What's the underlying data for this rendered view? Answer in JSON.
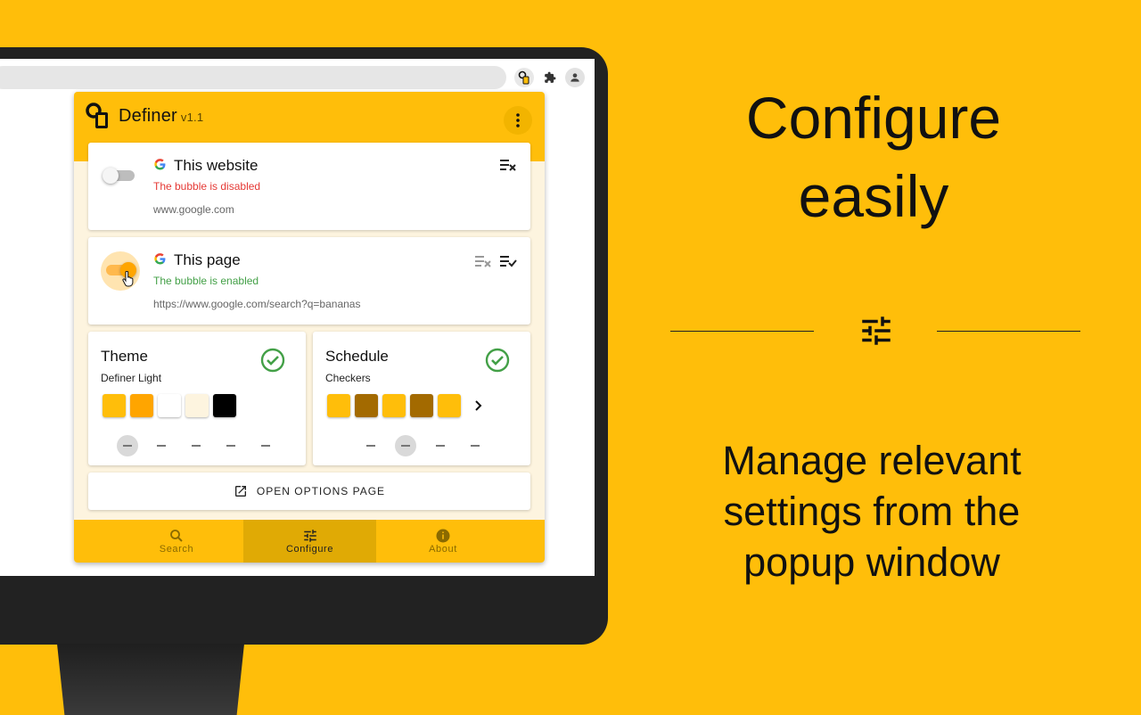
{
  "popup": {
    "title": "Definer",
    "version": "v1.1"
  },
  "website_card": {
    "title": "This website",
    "status": "The bubble is disabled",
    "url": "www.google.com",
    "toggle_enabled": false
  },
  "page_card": {
    "title": "This page",
    "status": "The bubble is enabled",
    "url": "https://www.google.com/search?q=bananas",
    "toggle_enabled": true
  },
  "theme_card": {
    "title": "Theme",
    "subtitle": "Definer Light",
    "swatches": [
      "#FFBE0A",
      "#FFA500",
      "#FFFFFF",
      "#FDF4DF",
      "#000000"
    ]
  },
  "schedule_card": {
    "title": "Schedule",
    "subtitle": "Checkers",
    "swatches": [
      "#FFBE0A",
      "#A36A00",
      "#FFBE0A",
      "#A36A00",
      "#FFBE0A"
    ]
  },
  "options_button": {
    "label": "OPEN OPTIONS PAGE"
  },
  "nav": {
    "search": "Search",
    "configure": "Configure",
    "about": "About",
    "active": "configure"
  },
  "promo": {
    "heading_line1": "Configure",
    "heading_line2": "easily",
    "sub_line1": "Manage relevant",
    "sub_line2": "settings from the",
    "sub_line3": "popup window"
  },
  "colors": {
    "accent": "#FFBE0A",
    "success": "#43A047",
    "error": "#E53935"
  }
}
